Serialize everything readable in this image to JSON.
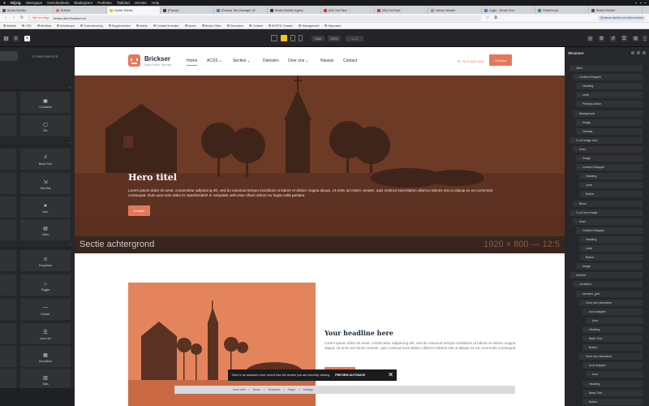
{
  "menubar": {
    "items": [
      "Wijzig",
      "Weergave",
      "Geschiedenis",
      "Bladwijzers",
      "Profielen",
      "Tabblad",
      "Venster",
      "Help"
    ],
    "right": [
      "",
      "",
      ""
    ]
  },
  "tabs": [
    {
      "title": "Bricks Builder",
      "color": "#555",
      "active": false
    },
    {
      "title": "Builder",
      "color": "#e4785a",
      "active": false
    },
    {
      "title": "Home: Bricks",
      "color": "#f5c518",
      "active": true
    },
    {
      "title": "(Pause)",
      "color": "#444",
      "active": false
    },
    {
      "title": "(Pause) Tab Manager v3",
      "color": "#4a7bd0",
      "active": false
    },
    {
      "title": "Bricks Builder Agenc",
      "color": "#3d3d3d",
      "active": false
    },
    {
      "title": "(59) YouTube",
      "color": "#e03030",
      "active": false
    },
    {
      "title": "(59) YouTube",
      "color": "#e03030",
      "active": false
    },
    {
      "title": "Nieuw Venster",
      "color": "#999",
      "active": false
    },
    {
      "title": "Login · Email Over",
      "color": "#4a7bd0",
      "active": false
    },
    {
      "title": "Onderhoud",
      "color": "#3a9b5c",
      "active": false
    },
    {
      "title": "Bricks Builder",
      "color": "#555",
      "active": false
    }
  ],
  "address": {
    "chip": "Niet beveiligd",
    "url": "bricks.dev/?bricks=run",
    "update_label": "Opnieuw starten om bij te werken"
  },
  "bookmarks": [
    "Airtable",
    "CSS",
    "Webflow",
    "Workshops",
    "Ondersteuning",
    "Supplementen",
    "Admin",
    "Contact formulier",
    "Opera",
    "Bricks Editor",
    "Gevonden",
    "Content",
    "ISOPOL Dossier",
    "Management",
    "Afspraken"
  ],
  "left_panel": {
    "tab_components": "COMPONENTS",
    "elements": [
      {
        "label": "Container",
        "icon": "▣"
      },
      {
        "label": "Div",
        "icon": "▢"
      },
      {
        "label": "Basic Text",
        "icon": "≡"
      },
      {
        "label": "Text link",
        "icon": "⇲"
      },
      {
        "label": "Icon",
        "icon": "★"
      },
      {
        "label": "Video",
        "icon": "▤"
      },
      {
        "label": "Dropdown",
        "icon": "⊙"
      },
      {
        "label": "Toggle",
        "icon": "♨"
      },
      {
        "label": "Divider",
        "icon": "—"
      },
      {
        "label": "Icon List",
        "icon": "☰"
      },
      {
        "label": "Accordion",
        "icon": "▦"
      },
      {
        "label": "Tabs",
        "icon": "▥"
      }
    ]
  },
  "toolbar": {
    "width_value": "1366",
    "zoom_value": "100%",
    "active_device": "desktop"
  },
  "site": {
    "logo_name": "Brickser",
    "logo_tagline": "Bricks Builder Template",
    "nav": [
      "Home",
      "ACSS",
      "Secties",
      "Diensten",
      "Over ons",
      "Nieuws",
      "Contact"
    ],
    "nav_dropdowns": {
      "ACSS": "⌄",
      "Secties": "⌄",
      "Over ons": "⌄"
    },
    "phone": "+31 6 0000 0000",
    "contact_button": "Contact",
    "hero_title": "Hero titel",
    "hero_text": "Lorem ipsum dolor sit amet, consectetur adipiscing elit, sed do eiusmod tempor incididunt ut labore et dolore magna aliqua. Ut enim ad minim veniam, quis nostrud exercitation ullamco laboris nisi ut aliquip ex ea commodo consequat. Duis aute irure dolor in reprehenderit in voluptate velit esse cillum dolore eu fugiat nulla pariatur.",
    "hero_button": "Contact",
    "hero_caption_left": "Sectie achtergrond",
    "hero_caption_right": "1920 × 800 — 12:5",
    "section_title": "Your headline here",
    "section_text": "Lorem ipsum dolor sit amet, consectetur adipiscing elit, sed do eiusmod tempor incididunt ut labore et dolore magna aliqua. Ut enim ad minim veniam, quis nostrud exercitation ullamco laboris nisi ut aliquip ex ea commodo consequat."
  },
  "toast": {
    "message": "There is an autosave more recent than the version you are currently viewing.",
    "action": "PREVIEW AUTOSAVE",
    "close": "✕"
  },
  "statusbar": [
    "Save draft",
    "Bricks",
    "Templates",
    "Pages",
    "Settings"
  ],
  "structure": {
    "title": "Structure",
    "nodes": [
      {
        "label": "Hero",
        "level": 0
      },
      {
        "label": "Content Wrapper",
        "level": 1
      },
      {
        "label": "Heading",
        "level": 2
      },
      {
        "label": "Lede",
        "level": 2
      },
      {
        "label": "Primary Action",
        "level": 2
      },
      {
        "label": "Background",
        "level": 1
      },
      {
        "label": "Image",
        "level": 2
      },
      {
        "label": "Overlay",
        "level": 2
      },
      {
        "label": "2-col Image Icon",
        "level": 0
      },
      {
        "label": "Inner",
        "level": 1
      },
      {
        "label": "Image",
        "level": 2
      },
      {
        "label": "Content Wrapper",
        "level": 2
      },
      {
        "label": "Heading",
        "level": 3
      },
      {
        "label": "Lede",
        "level": 3
      },
      {
        "label": "Button",
        "level": 3
      },
      {
        "label": "Block",
        "level": 1
      },
      {
        "label": "2-col Icon Image",
        "level": 0
      },
      {
        "label": "Inner",
        "level": 1
      },
      {
        "label": "Content Wrapper",
        "level": 2
      },
      {
        "label": "Heading",
        "level": 3
      },
      {
        "label": "Lede",
        "level": 3
      },
      {
        "label": "Button",
        "level": 3
      },
      {
        "label": "Image",
        "level": 2
      },
      {
        "label": "Section",
        "level": 0
      },
      {
        "label": "Container",
        "level": 1
      },
      {
        "label": "services_grid",
        "level": 2
      },
      {
        "label": "Card Icon animation",
        "level": 3
      },
      {
        "label": "Icon wrapper",
        "level": 4
      },
      {
        "label": "Icon",
        "level": 5
      },
      {
        "label": "Heading",
        "level": 4
      },
      {
        "label": "Basic Text",
        "level": 4
      },
      {
        "label": "Button",
        "level": 4
      },
      {
        "label": "Card Icon animation",
        "level": 3
      },
      {
        "label": "Icon wrapper",
        "level": 4
      },
      {
        "label": "Icon",
        "level": 5
      },
      {
        "label": "Heading",
        "level": 4
      },
      {
        "label": "Basic Text",
        "level": 4
      },
      {
        "label": "Button",
        "level": 4
      }
    ]
  },
  "colors": {
    "accent": "#e4785a",
    "hero_bg": "#6e3a24",
    "panel_bg": "#26272b"
  }
}
